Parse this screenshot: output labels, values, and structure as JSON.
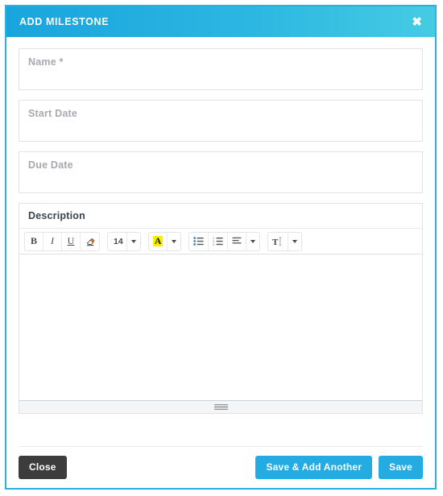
{
  "modal": {
    "title": "ADD MILESTONE",
    "close_icon": "close-icon",
    "accent_color": "#29b0e0",
    "header_gradient_from": "#19a4dd",
    "header_gradient_to": "#45cbe3"
  },
  "form": {
    "fields": [
      {
        "name": "name",
        "placeholder": "Name *",
        "value": ""
      },
      {
        "name": "start_date",
        "placeholder": "Start Date",
        "value": ""
      },
      {
        "name": "due_date",
        "placeholder": "Due Date",
        "value": ""
      }
    ],
    "description": {
      "label": "Description",
      "value": "",
      "toolbar": {
        "bold": "B",
        "italic": "I",
        "underline": "U",
        "remove_format_icon": "eraser-icon",
        "font_size": "14",
        "highlight_letter": "A",
        "highlight_color": "#ffec00",
        "unordered_list_icon": "unordered-list-icon",
        "ordered_list_icon": "ordered-list-icon",
        "align_icon": "align-left-icon",
        "line_height_icon": "line-height-icon"
      },
      "resize_grip": "resize-grip-icon"
    }
  },
  "footer": {
    "close_label": "Close",
    "save_add_another_label": "Save & Add Another",
    "save_label": "Save",
    "close_color": "#3c3c3c",
    "primary_color": "#23abe2"
  }
}
